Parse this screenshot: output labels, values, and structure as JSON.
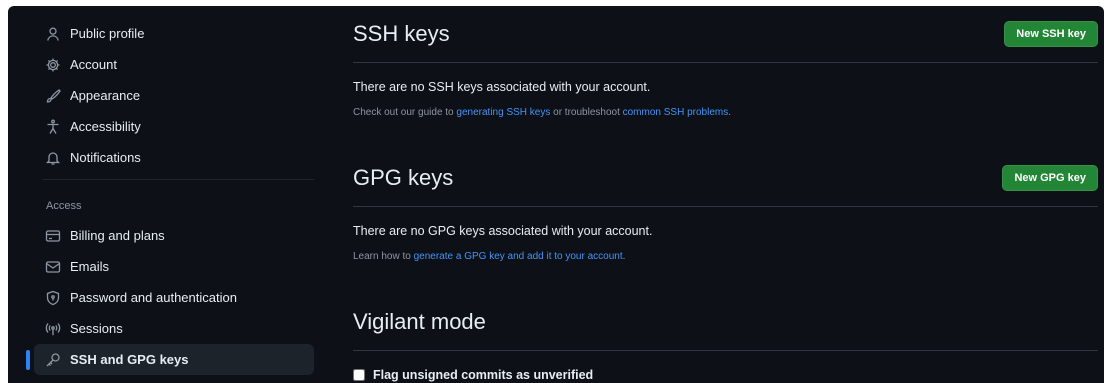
{
  "sidebar": {
    "items_top": [
      {
        "label": "Public profile",
        "icon": "person-icon"
      },
      {
        "label": "Account",
        "icon": "gear-icon"
      },
      {
        "label": "Appearance",
        "icon": "paintbrush-icon"
      },
      {
        "label": "Accessibility",
        "icon": "accessibility-icon"
      },
      {
        "label": "Notifications",
        "icon": "bell-icon"
      }
    ],
    "access_label": "Access",
    "items_access": [
      {
        "label": "Billing and plans",
        "icon": "credit-card-icon"
      },
      {
        "label": "Emails",
        "icon": "mail-icon"
      },
      {
        "label": "Password and authentication",
        "icon": "shield-lock-icon"
      },
      {
        "label": "Sessions",
        "icon": "broadcast-icon"
      },
      {
        "label": "SSH and GPG keys",
        "icon": "key-icon",
        "active": true
      }
    ]
  },
  "ssh": {
    "title": "SSH keys",
    "button": "New SSH key",
    "empty": "There are no SSH keys associated with your account.",
    "hint_pre": "Check out our guide to ",
    "hint_link1": "generating SSH keys",
    "hint_mid": " or troubleshoot ",
    "hint_link2": "common SSH problems",
    "hint_post": "."
  },
  "gpg": {
    "title": "GPG keys",
    "button": "New GPG key",
    "empty": "There are no GPG keys associated with your account.",
    "hint_pre": "Learn how to ",
    "hint_link": "generate a GPG key and add it to your account",
    "hint_post": "."
  },
  "vigilant": {
    "title": "Vigilant mode",
    "checkbox_label": "Flag unsigned commits as unverified"
  },
  "colors": {
    "background": "#0d1117",
    "accent_blue": "#2f81f7",
    "button_green": "#238636",
    "link": "#4493f8"
  }
}
